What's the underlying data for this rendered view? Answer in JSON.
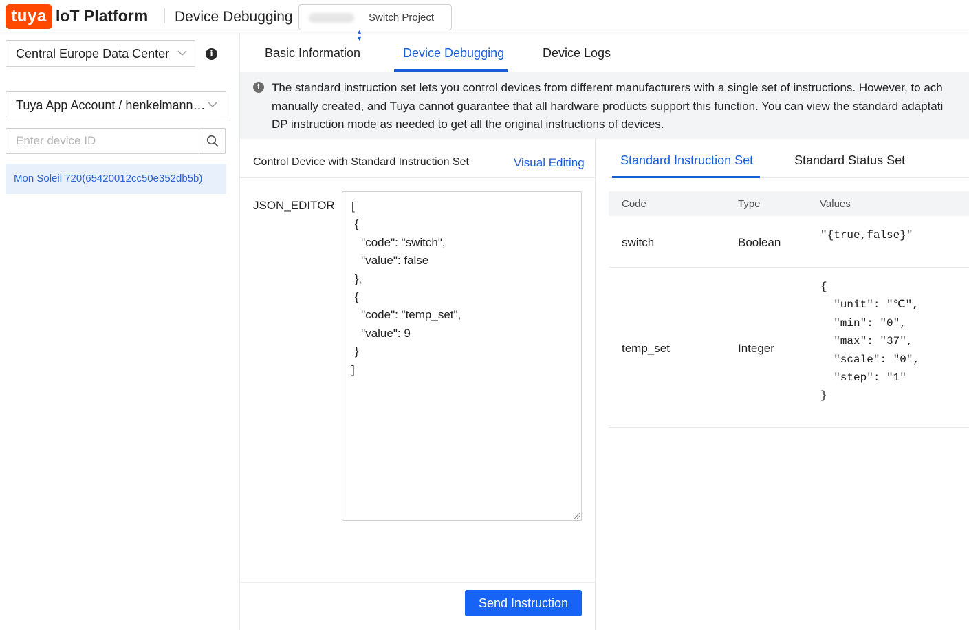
{
  "header": {
    "logo": "tuya",
    "platform": "IoT Platform",
    "title": "Device Debugging",
    "project": "Switch Project"
  },
  "sidebar": {
    "data_center": "Central Europe Data Center",
    "account": "Tuya App Account / henkelmann…",
    "search_placeholder": "Enter device ID",
    "devices": [
      {
        "label": "Mon Soleil 720(65420012cc50e352db5b)"
      }
    ]
  },
  "tabs": [
    {
      "label": "Basic Information"
    },
    {
      "label": "Device Debugging"
    },
    {
      "label": "Device Logs"
    }
  ],
  "banner": {
    "lines": [
      "The standard instruction set lets you control devices from different manufacturers with a single set of instructions. However, to ach",
      "manually created, and Tuya cannot guarantee that all hardware products support this function. You can view the standard adaptati",
      "DP instruction mode as needed to get all the original instructions of devices."
    ]
  },
  "control": {
    "title": "Control Device with Standard Instruction Set",
    "visual_link": "Visual Editing",
    "editor_label": "JSON_EDITOR",
    "json_value": "[\n {\n   \"code\": \"switch\",\n   \"value\": false\n },\n {\n   \"code\": \"temp_set\",\n   \"value\": 9\n }\n]",
    "send_button": "Send Instruction"
  },
  "instruction_tabs": [
    {
      "label": "Standard Instruction Set"
    },
    {
      "label": "Standard Status Set"
    }
  ],
  "instruction_table": {
    "headers": [
      "Code",
      "Type",
      "Values"
    ],
    "rows": [
      {
        "code": "switch",
        "type": "Boolean",
        "values": "\"{true,false}\""
      },
      {
        "code": "temp_set",
        "type": "Integer",
        "values": "{\n  \"unit\": \"℃\",\n  \"min\": \"0\",\n  \"max\": \"37\",\n  \"scale\": \"0\",\n  \"step\": \"1\"\n}"
      }
    ]
  },
  "colors": {
    "brand": "#ff4800",
    "accent": "#1a5dd8",
    "primary_button": "#1763f5",
    "selected_bg": "#e8f0fc"
  }
}
